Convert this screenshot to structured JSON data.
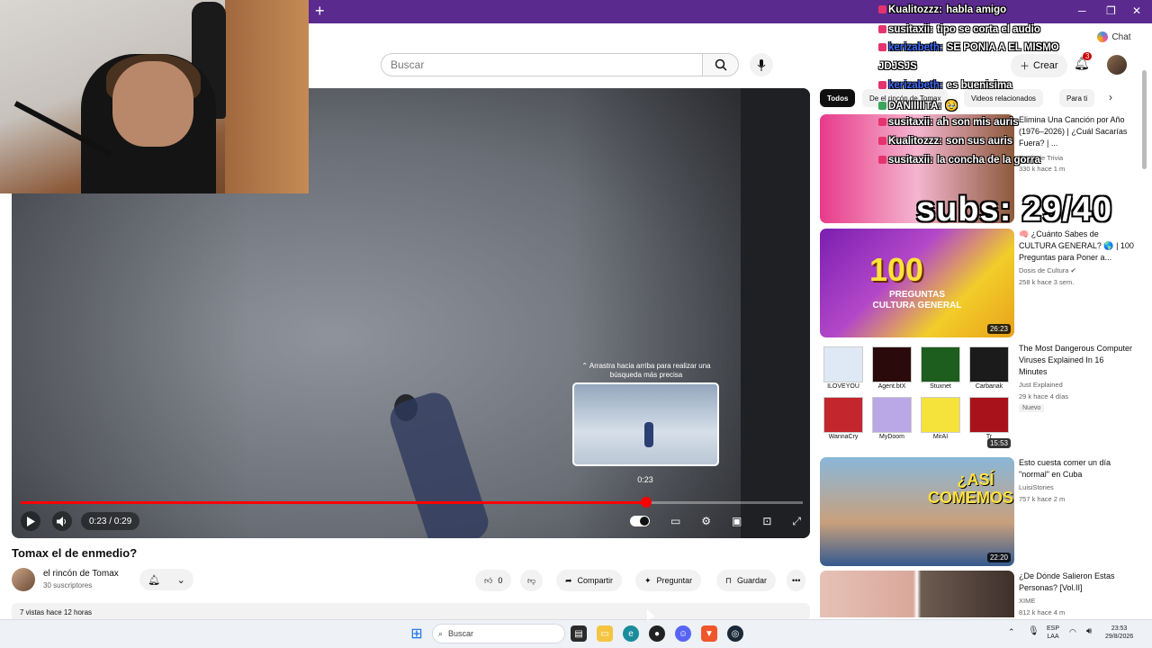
{
  "browser": {
    "new_tab_symbol": "+",
    "minimize": "─",
    "maximize": "❐",
    "close": "✕",
    "chat_label": "Chat"
  },
  "header": {
    "search_placeholder": "Buscar",
    "create_label": "Crear",
    "notification_count": "3"
  },
  "video": {
    "seek_hint": "⌃ Arrastra hacia arriba para realizar una búsqueda más precisa",
    "preview_time": "0:23",
    "time_display": "0:23 / 0:29",
    "progress_fraction": 0.8,
    "title": "Tomax el de enmedio?"
  },
  "channel": {
    "name": "el rincón de Tomax",
    "subscribers": "30 suscriptores"
  },
  "actions": {
    "likes": "0",
    "share": "Compartir",
    "ask": "Preguntar",
    "save": "Guardar"
  },
  "description": {
    "stats": "7 vistas  hace 12 horas"
  },
  "chips": [
    "Todos",
    "De el rincón de Tomax",
    "Videos relacionados",
    "Para ti"
  ],
  "recommended": [
    {
      "title": "Elimina Una Canción por Año (1976–2026) | ¿Cuál Sacarías Fuera? | ...",
      "channel": "Dosis de Trivia",
      "meta": "330 k  hace 1 m",
      "duration": ""
    },
    {
      "title": "🧠 ¿Cuánto Sabes de CULTURA GENERAL? 🌎 | 100 Preguntas para Poner a...",
      "channel": "Dosis de Cultura ✔",
      "meta": "258 k  hace 3 sem.",
      "duration": "26:23",
      "thumb_big": "100",
      "thumb_sub": "PREGUNTAS CULTURA GENERAL"
    },
    {
      "title": "The Most Dangerous Computer Viruses Explained In 16 Minutes",
      "channel": "Just Explained",
      "meta": "29 k  hace 4 días",
      "badge": "Nuevo",
      "duration": "15:53",
      "viruses": [
        "ILOVEYOU",
        "Agent.btX",
        "Stuxnet",
        "Carbanak",
        "WannaCry",
        "MyDoom",
        "MirAI",
        "Tr"
      ]
    },
    {
      "title": "Esto cuesta comer un día \"normal\" en Cuba",
      "channel": "LuisiStories",
      "meta": "757 k  hace 2 m",
      "duration": "22:20",
      "thumb_text": "¿ASÍ COMEMOS?"
    },
    {
      "title": "¿De Dónde Salieron Estas Personas? [Vol.II]",
      "channel": "XIME",
      "meta": "812 k  hace 4 m",
      "duration": ""
    }
  ],
  "chat": [
    {
      "nick": "Kualitozzz:",
      "msg": "habla amigo",
      "color": "#ffffff",
      "badge": "#e6336e"
    },
    {
      "nick": "susitaxii:",
      "msg": "tipo se corta el audio",
      "color": "#ffffff",
      "badge": "#e6336e"
    },
    {
      "nick": "kerizabeth:",
      "msg": "SE PONIA A EL MISMO",
      "color": "#3e6bff",
      "badge": "#e6336e"
    },
    {
      "nick": "",
      "msg": "JDJSJS",
      "color": "#ffffff",
      "badge": ""
    },
    {
      "nick": "kerizabeth:",
      "msg": "es buenisima",
      "color": "#3e6bff",
      "badge": "#e6336e"
    },
    {
      "nick": "DANIIIIITA:",
      "msg": "🥹",
      "color": "#ffffff",
      "badge": "#3aa55d"
    },
    {
      "nick": "susitaxii:",
      "msg": "ah son mis auris",
      "color": "#ffffff",
      "badge": "#e6336e"
    },
    {
      "nick": "Kualitozzz:",
      "msg": "son sus auris",
      "color": "#ffffff",
      "badge": "#e6336e"
    },
    {
      "nick": "susitaxii:",
      "msg": "la concha de la gorra",
      "color": "#ffffff",
      "badge": "#e6336e"
    }
  ],
  "subs_goal": "subs: 29/40",
  "taskbar": {
    "search_placeholder": "Buscar",
    "lang": "ESP",
    "layout": "LAA",
    "time": "23:53",
    "date": "29/8/2026"
  },
  "colors": {
    "browser_bar": "#5a2a8f",
    "accent_red": "#ff0000"
  }
}
